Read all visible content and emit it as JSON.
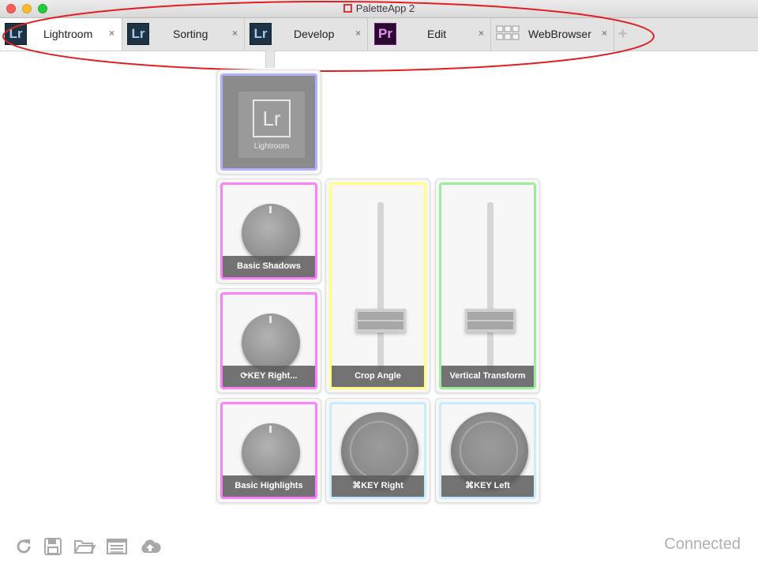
{
  "window": {
    "title": "PaletteApp 2"
  },
  "tabs": [
    {
      "label": "Lightroom",
      "icon": "Lr",
      "icon_name": "lightroom-app-icon",
      "active": true
    },
    {
      "label": "Sorting",
      "icon": "Lr",
      "icon_name": "lightroom-app-icon",
      "active": false
    },
    {
      "label": "Develop",
      "icon": "Lr",
      "icon_name": "lightroom-app-icon",
      "active": false
    },
    {
      "label": "Edit",
      "icon": "Pr",
      "icon_name": "premiere-app-icon",
      "active": false
    },
    {
      "label": "WebBrowser",
      "icon": "",
      "icon_name": "keyboard-keys-icon",
      "active": false
    }
  ],
  "tab_close_glyph": "×",
  "add_tab_glyph": "+",
  "palette": {
    "hub": {
      "logo": "Lr",
      "name": "Lightroom",
      "border_color": "#b0b0ff"
    },
    "modules": [
      {
        "type": "dial",
        "label": "Basic Shadows",
        "color": "#ff80ff"
      },
      {
        "type": "slider",
        "label": "Crop Angle",
        "color": "#ffff80"
      },
      {
        "type": "slider",
        "label": "Vertical Transform",
        "color": "#99f099"
      },
      {
        "type": "dial",
        "label": "⟳KEY Right...",
        "color": "#ff80ff"
      },
      {
        "type": "dial",
        "label": "Basic Highlights",
        "color": "#ff80ff"
      },
      {
        "type": "wheel",
        "label": "⌘KEY Right",
        "color": "#c8ecff"
      },
      {
        "type": "wheel",
        "label": "⌘KEY Left",
        "color": "#c8ecff"
      }
    ]
  },
  "footer": {
    "icons": [
      "refresh-icon",
      "save-icon",
      "open-folder-icon",
      "list-icon",
      "cloud-upload-icon"
    ],
    "status": "Connected"
  },
  "colors": {
    "annotation": "#e02020"
  }
}
